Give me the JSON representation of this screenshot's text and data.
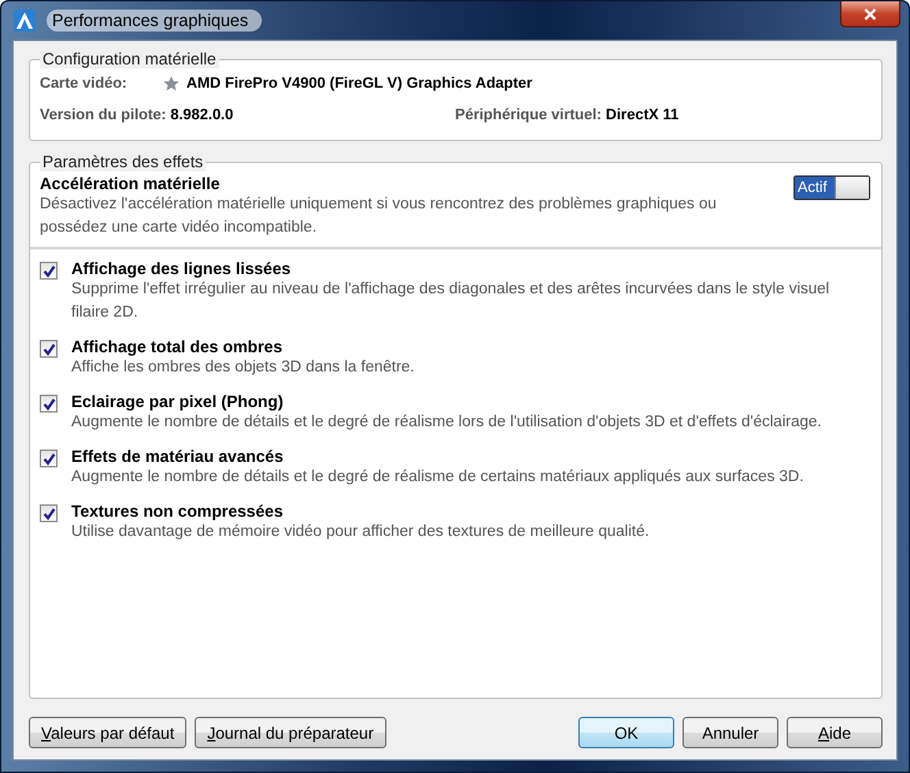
{
  "window": {
    "title": "Performances graphiques"
  },
  "hardware": {
    "title": "Configuration matérielle",
    "card_label": "Carte vidéo:",
    "card_value": "AMD FirePro V4900 (FireGL V) Graphics Adapter",
    "driver_label": "Version du pilote:",
    "driver_value": "8.982.0.0",
    "virtual_label": "Périphérique virtuel:",
    "virtual_value": "DirectX 11"
  },
  "effects": {
    "title": "Paramètres des effets",
    "acceleration": {
      "title": "Accélération matérielle",
      "description": "Désactivez l'accélération matérielle uniquement si vous rencontrez des problèmes graphiques ou possédez une carte vidéo incompatible.",
      "toggle_label": "Actif",
      "on": true
    },
    "options": [
      {
        "label": "Affichage des lignes lissées",
        "description": "Supprime l'effet irrégulier au niveau de l'affichage des diagonales et des arêtes incurvées dans le style visuel filaire 2D.",
        "checked": true
      },
      {
        "label": "Affichage total des ombres",
        "description": "Affiche les ombres des objets 3D dans la fenêtre.",
        "checked": true
      },
      {
        "label": "Eclairage par pixel (Phong)",
        "description": "Augmente le nombre de détails et le degré de réalisme lors de l'utilisation d'objets 3D et d'effets d'éclairage.",
        "checked": true
      },
      {
        "label": "Effets de matériau avancés",
        "description": "Augmente le nombre de détails et le degré de réalisme de certains matériaux appliqués aux surfaces 3D.",
        "checked": true
      },
      {
        "label": "Textures non compressées",
        "description": "Utilise davantage de mémoire vidéo pour afficher des textures de meilleure qualité.",
        "checked": true
      }
    ]
  },
  "buttons_left": [
    {
      "label": "Valeurs par défaut",
      "access_key": true
    },
    {
      "label": "Journal du préparateur",
      "access_key": true
    }
  ],
  "buttons_right": [
    {
      "label": "OK",
      "access_key": false,
      "default": true
    },
    {
      "label": "Annuler",
      "access_key": false,
      "default": false
    },
    {
      "label": "Aide",
      "access_key": true,
      "default": false
    }
  ]
}
